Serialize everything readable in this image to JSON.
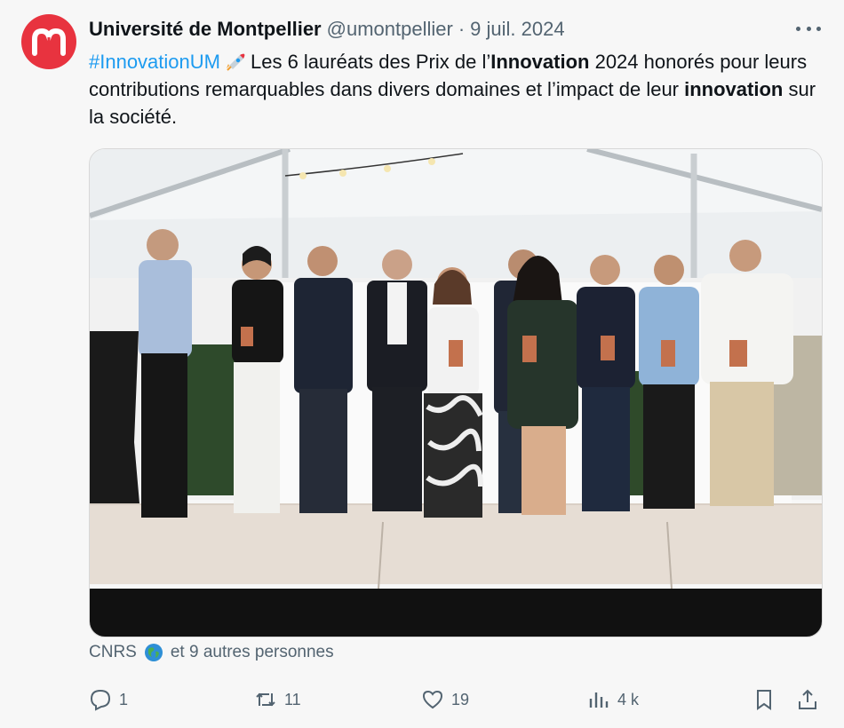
{
  "author": {
    "name": "Université de Montpellier",
    "handle": "@umontpellier",
    "separator": "·",
    "date": "9 juil. 2024"
  },
  "tweet": {
    "hashtag": "#InnovationUM",
    "t1": "Les 6 lauréats des Prix de l’",
    "b1": "Innovation",
    "t2": " 2024 honorés pour leurs contributions remarquables dans divers domaines et l’impact de leur ",
    "b2": "innovation",
    "t3": " sur la société."
  },
  "likers": {
    "first": "CNRS",
    "rest": "et 9 autres personnes"
  },
  "actions": {
    "replies": "1",
    "retweets": "11",
    "likes": "19",
    "views": "4 k"
  },
  "icons": [
    "more-icon",
    "rocket-icon",
    "globe-icon",
    "reply-icon",
    "retweet-icon",
    "like-icon",
    "views-icon",
    "bookmark-icon",
    "share-icon"
  ],
  "colors": {
    "accent": "#1d9bf0",
    "brand": "#e8333f",
    "muted": "#536471"
  }
}
